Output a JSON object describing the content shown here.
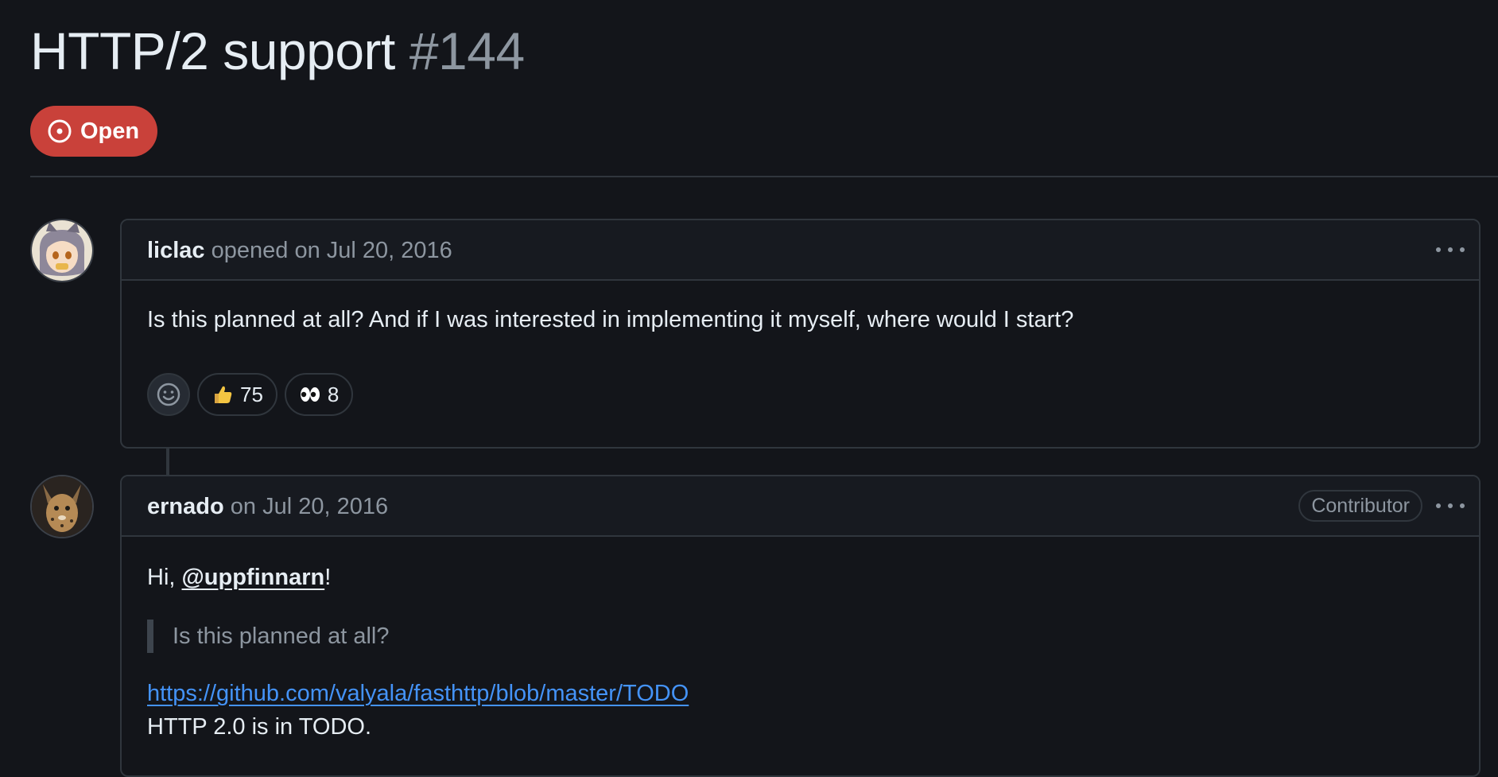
{
  "issue": {
    "title": "HTTP/2 support",
    "number": "#144",
    "state": "Open",
    "state_color": "#c9413a"
  },
  "comments": [
    {
      "author": "liclac",
      "action": "opened on Jul 20, 2016",
      "body": "Is this planned at all? And if I was interested in implementing it myself, where would I start?",
      "reactions": [
        {
          "emoji": "thumbs-up",
          "count": "75"
        },
        {
          "emoji": "eyes",
          "count": "8"
        }
      ]
    },
    {
      "author": "ernado",
      "action": "on Jul 20, 2016",
      "role": "Contributor",
      "greeting_prefix": "Hi, ",
      "mention": "@uppfinnarn",
      "greeting_suffix": "!",
      "quote": "Is this planned at all?",
      "link": "https://github.com/valyala/fasthttp/blob/master/TODO",
      "text": "HTTP 2.0 is in TODO."
    }
  ],
  "colors": {
    "background": "#13151a",
    "link": "#4493f8",
    "muted": "#8d96a0",
    "border": "#30363d"
  }
}
